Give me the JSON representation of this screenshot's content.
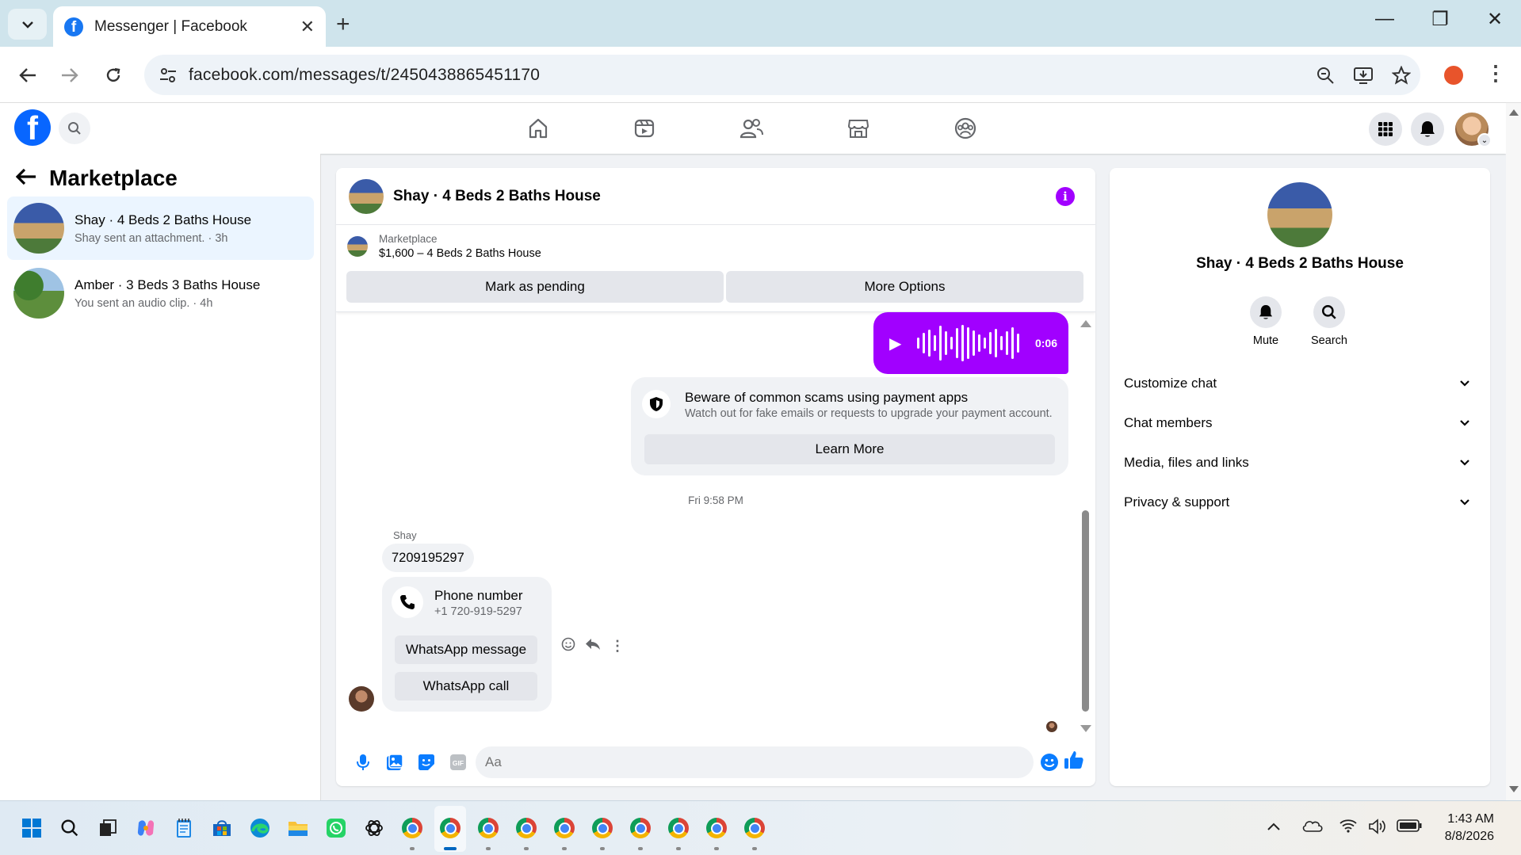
{
  "browser": {
    "tab_title": "Messenger | Facebook",
    "url": "facebook.com/messages/t/2450438865451170"
  },
  "sidebar": {
    "title": "Marketplace",
    "conversations": [
      {
        "name": "Shay · 4 Beds 2 Baths House",
        "preview": "Shay sent an attachment. · 3h",
        "active": true
      },
      {
        "name": "Amber · 3 Beds 3 Baths House",
        "preview": "You sent an audio clip. · 4h",
        "active": false
      }
    ]
  },
  "chat": {
    "title": "Shay · 4 Beds 2 Baths House",
    "marketplace_label": "Marketplace",
    "listing": "$1,600 – 4 Beds 2 Baths House",
    "mark_pending_label": "Mark as pending",
    "more_options_label": "More Options",
    "audio_duration": "0:06",
    "scam_title": "Beware of common scams using payment apps",
    "scam_body": "Watch out for fake emails or requests to upgrade your payment account.",
    "learn_more_label": "Learn More",
    "timestamp": "Fri 9:58 PM",
    "sender_name": "Shay",
    "phone_message": "7209195297",
    "phone_card_title": "Phone number",
    "phone_card_number": "+1 720-919-5297",
    "whatsapp_message_label": "WhatsApp message",
    "whatsapp_call_label": "WhatsApp call",
    "composer_placeholder": "Aa"
  },
  "details": {
    "name": "Shay · 4 Beds 2 Baths House",
    "mute_label": "Mute",
    "search_label": "Search",
    "sections": [
      "Customize chat",
      "Chat members",
      "Media, files and links",
      "Privacy & support"
    ]
  },
  "taskbar": {
    "time": "1:43 AM",
    "date": "8/8/2026"
  },
  "colors": {
    "accent": "#a100ff",
    "facebook_blue": "#0866ff",
    "messenger_blue": "#0a7cff"
  }
}
